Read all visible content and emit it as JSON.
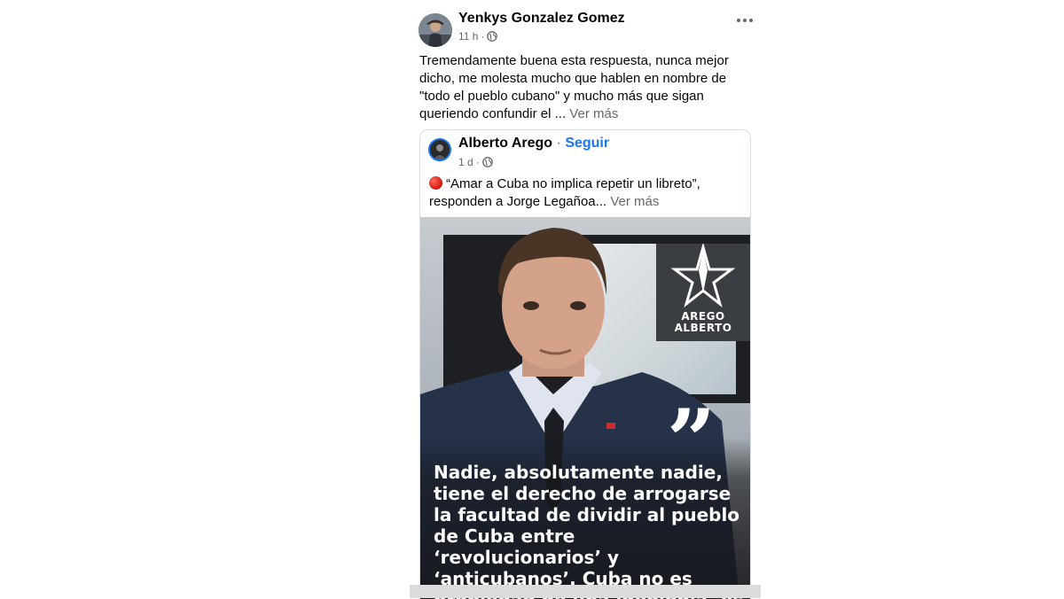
{
  "post": {
    "author": "Yenkys Gonzalez Gomez",
    "time": "11 h",
    "separator": "·",
    "text": "Tremendamente buena esta respuesta, nunca mejor dicho, me molesta mucho que hablen en nombre de \"todo el pueblo cubano\" y mucho más que sigan queriendo confundir el ...",
    "see_more": "Ver más",
    "more_icon": "ellipsis-icon",
    "privacy_icon": "globe-icon"
  },
  "shared": {
    "author": "Alberto Arego",
    "separator": "·",
    "follow": "Seguir",
    "time": "1 d",
    "text": "“Amar a Cuba no implica repetir un libreto”, responden a Jorge Legañoa...",
    "see_more": "Ver más",
    "status_icon": "red-circle-icon",
    "logo_line1": "AREGO",
    "logo_line2": "ALBERTO",
    "quote_mark": "”",
    "quote": "Nadie, absolutamente nadie, tiene el derecho de arrogarse la facultad de dividir al pueblo de Cuba entre ‘revolucionarios’ y ‘anticubanos’. Cuba no es propiedad de una ideología, es"
  },
  "colors": {
    "link": "#1877f2",
    "muted": "#65676b",
    "text": "#050505"
  }
}
